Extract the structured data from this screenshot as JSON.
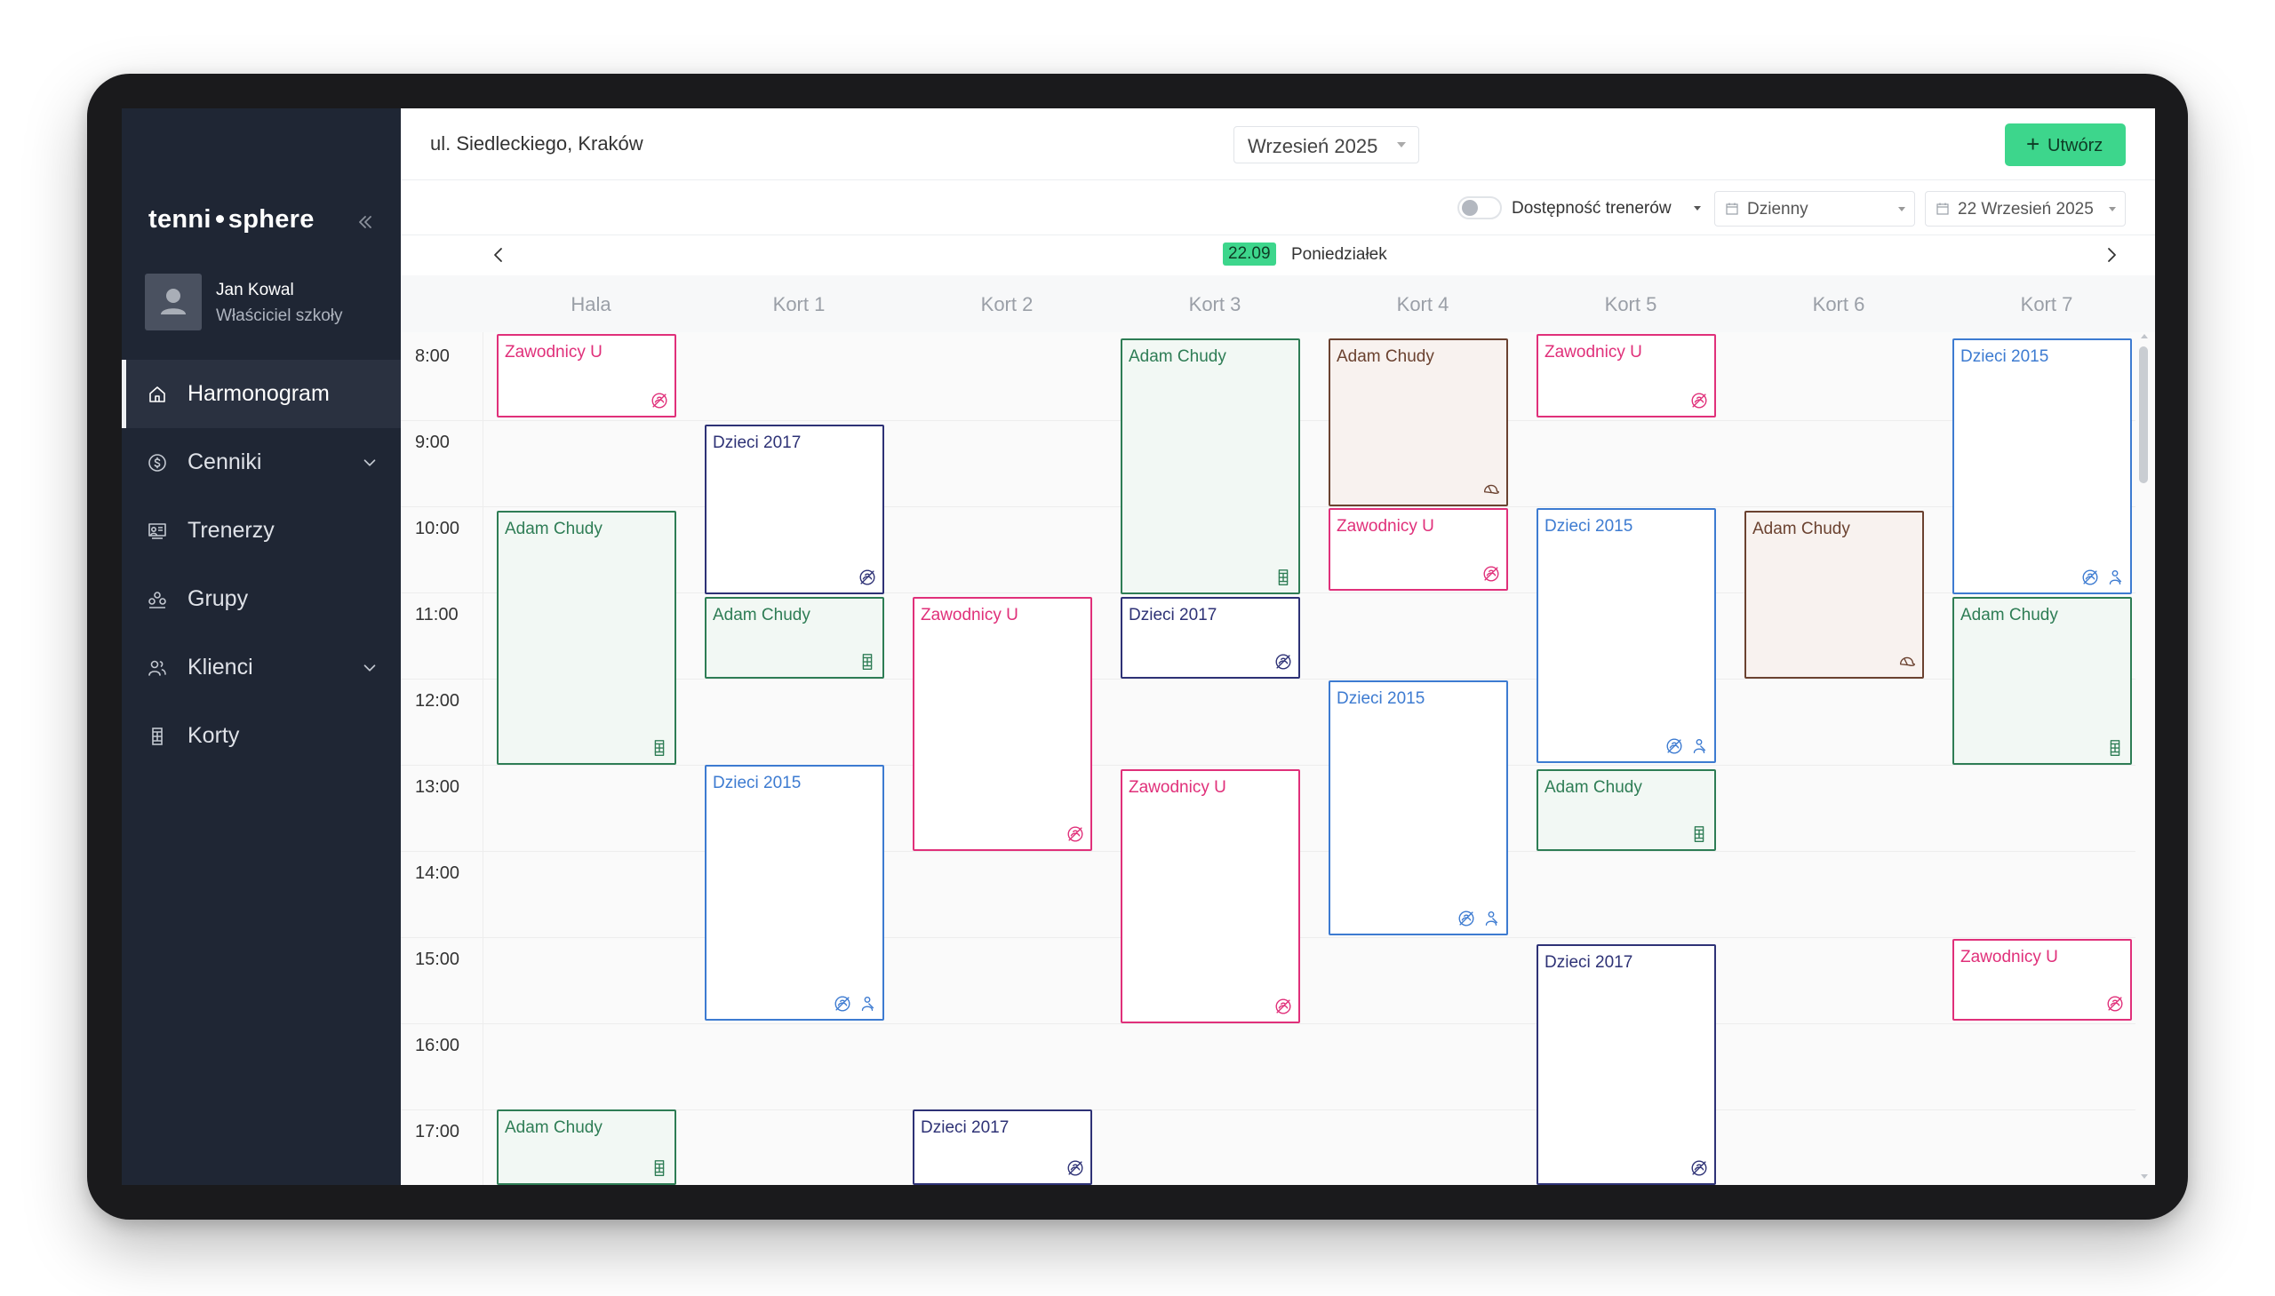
{
  "sidebar": {
    "logo_left": "tenni",
    "logo_right": "sphere",
    "user": {
      "name": "Jan Kowal",
      "role": "Właściciel szkoły"
    },
    "items": [
      {
        "label": "Harmonogram",
        "icon": "home-icon",
        "active": true,
        "expandable": false
      },
      {
        "label": "Cenniki",
        "icon": "dollar-circle-icon",
        "active": false,
        "expandable": true
      },
      {
        "label": "Trenerzy",
        "icon": "trainer-board-icon",
        "active": false,
        "expandable": false
      },
      {
        "label": "Grupy",
        "icon": "group-icon",
        "active": false,
        "expandable": false
      },
      {
        "label": "Klienci",
        "icon": "users-icon",
        "active": false,
        "expandable": true
      },
      {
        "label": "Korty",
        "icon": "court-icon",
        "active": false,
        "expandable": false
      }
    ]
  },
  "header": {
    "location": "ul. Siedleckiego, Kraków",
    "month": "Wrzesień 2025",
    "create_label": "Utwórz"
  },
  "filters": {
    "trainer_availability": "Dostępność trenerów",
    "view": "Dzienny",
    "date": "22 Wrzesień 2025"
  },
  "day": {
    "badge": "22.09",
    "name": "Poniedziałek"
  },
  "columns": [
    "Hala",
    "Kort 1",
    "Kort 2",
    "Kort 3",
    "Kort 4",
    "Kort 5",
    "Kort 6",
    "Kort 7"
  ],
  "times": [
    "8:00",
    "9:00",
    "10:00",
    "11:00",
    "12:00",
    "13:00",
    "14:00",
    "15:00",
    "16:00",
    "17:00"
  ],
  "colors": {
    "pink": "#e0307a",
    "blue": "#3d7bd1",
    "navy": "#2e3276",
    "green": "#2e7d55",
    "green_bg": "#f2f8f4",
    "brown": "#6b4230",
    "brown_bg": "#f8f2ef",
    "accent": "#3dd68c"
  },
  "events": [
    {
      "col": 0,
      "start": 8.0,
      "end": 8.97,
      "title": "Zawodnicy U",
      "style": "pink",
      "icons": [
        "no-trainer-icon"
      ]
    },
    {
      "col": 0,
      "start": 10.05,
      "end": 13.0,
      "title": "Adam Chudy",
      "style": "green",
      "icons": [
        "court-icon"
      ]
    },
    {
      "col": 0,
      "start": 17.0,
      "end": 18.0,
      "title": "Adam Chudy",
      "style": "green",
      "icons": [
        "court-icon"
      ]
    },
    {
      "col": 1,
      "start": 9.05,
      "end": 11.02,
      "title": "Dzieci 2017",
      "style": "navy",
      "icons": [
        "no-trainer-icon"
      ]
    },
    {
      "col": 1,
      "start": 11.05,
      "end": 12.0,
      "title": "Adam Chudy",
      "style": "green",
      "icons": [
        "court-icon"
      ]
    },
    {
      "col": 1,
      "start": 13.0,
      "end": 15.97,
      "title": "Dzieci 2015",
      "style": "blue",
      "icons": [
        "no-trainer-icon",
        "person-icon"
      ]
    },
    {
      "col": 2,
      "start": 11.05,
      "end": 14.0,
      "title": "Zawodnicy U",
      "style": "pink",
      "icons": [
        "no-trainer-icon"
      ]
    },
    {
      "col": 2,
      "start": 17.0,
      "end": 18.0,
      "title": "Dzieci 2017",
      "style": "navy",
      "icons": [
        "no-trainer-icon"
      ]
    },
    {
      "col": 3,
      "start": 8.05,
      "end": 11.02,
      "title": "Adam Chudy",
      "style": "green",
      "icons": [
        "court-icon"
      ]
    },
    {
      "col": 3,
      "start": 11.05,
      "end": 12.0,
      "title": "Dzieci 2017",
      "style": "navy",
      "icons": [
        "no-trainer-icon"
      ]
    },
    {
      "col": 3,
      "start": 13.05,
      "end": 16.0,
      "title": "Zawodnicy U",
      "style": "pink",
      "icons": [
        "no-trainer-icon"
      ]
    },
    {
      "col": 4,
      "start": 8.05,
      "end": 10.0,
      "title": "Adam Chudy",
      "style": "brown",
      "icons": [
        "cap-icon"
      ]
    },
    {
      "col": 4,
      "start": 10.02,
      "end": 10.98,
      "title": "Zawodnicy U",
      "style": "pink",
      "icons": [
        "no-trainer-icon"
      ]
    },
    {
      "col": 4,
      "start": 12.02,
      "end": 14.98,
      "title": "Dzieci 2015",
      "style": "blue",
      "icons": [
        "no-trainer-icon",
        "person-icon"
      ]
    },
    {
      "col": 5,
      "start": 8.0,
      "end": 8.97,
      "title": "Zawodnicy U",
      "style": "pink",
      "icons": [
        "no-trainer-icon"
      ]
    },
    {
      "col": 5,
      "start": 10.02,
      "end": 12.98,
      "title": "Dzieci 2015",
      "style": "blue",
      "icons": [
        "no-trainer-icon",
        "person-icon"
      ]
    },
    {
      "col": 5,
      "start": 13.05,
      "end": 14.0,
      "title": "Adam Chudy",
      "style": "green",
      "icons": [
        "court-icon"
      ]
    },
    {
      "col": 5,
      "start": 15.08,
      "end": 18.0,
      "title": "Dzieci 2017",
      "style": "navy",
      "icons": [
        "no-trainer-icon"
      ]
    },
    {
      "col": 6,
      "start": 10.05,
      "end": 12.0,
      "title": "Adam Chudy",
      "style": "brown",
      "icons": [
        "cap-icon"
      ]
    },
    {
      "col": 7,
      "start": 8.05,
      "end": 11.02,
      "title": "Dzieci 2015",
      "style": "blue",
      "icons": [
        "no-trainer-icon",
        "person-icon"
      ]
    },
    {
      "col": 7,
      "start": 11.05,
      "end": 13.0,
      "title": "Adam Chudy",
      "style": "green",
      "icons": [
        "court-icon"
      ]
    },
    {
      "col": 7,
      "start": 15.02,
      "end": 15.97,
      "title": "Zawodnicy U",
      "style": "pink",
      "icons": [
        "no-trainer-icon"
      ]
    }
  ]
}
